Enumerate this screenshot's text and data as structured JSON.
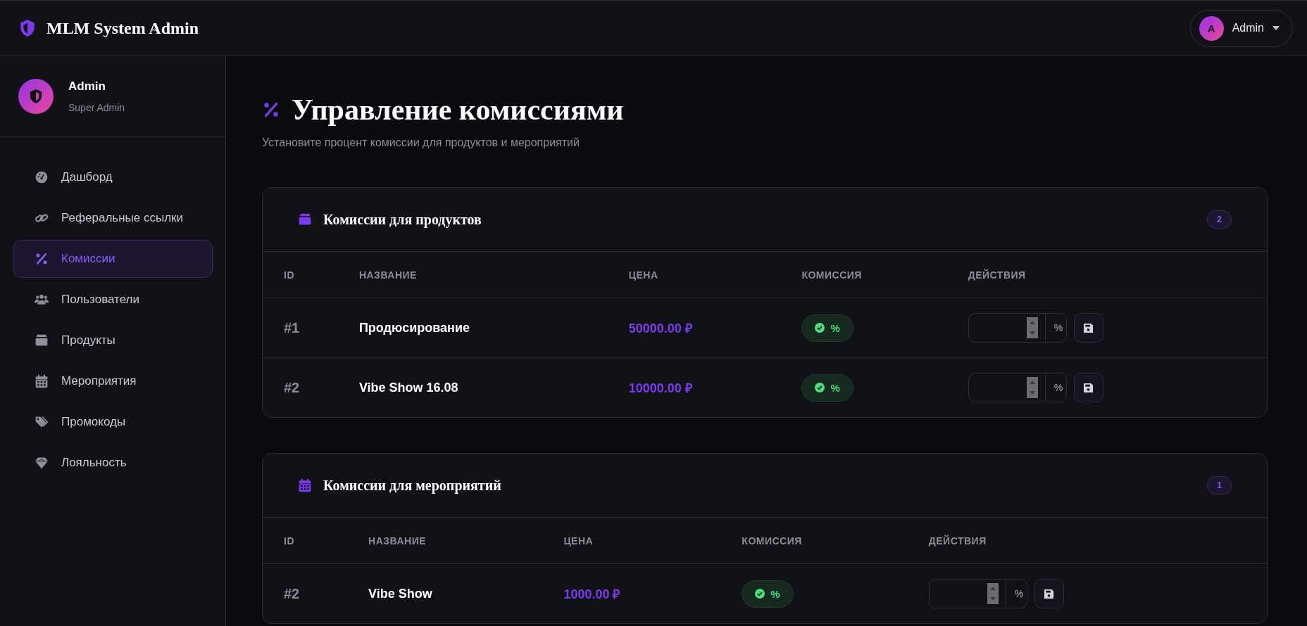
{
  "header": {
    "brand": "MLM System Admin",
    "user": {
      "initial": "A",
      "name": "Admin"
    }
  },
  "sidebar": {
    "profile": {
      "name": "Admin",
      "role": "Super Admin"
    },
    "items": [
      {
        "label": "Дашборд",
        "selected": false
      },
      {
        "label": "Реферальные ссылки",
        "selected": false
      },
      {
        "label": "Комиссии",
        "selected": true
      },
      {
        "label": "Пользователи",
        "selected": false
      },
      {
        "label": "Продукты",
        "selected": false
      },
      {
        "label": "Мероприятия",
        "selected": false
      },
      {
        "label": "Промокоды",
        "selected": false
      },
      {
        "label": "Лояльность",
        "selected": false
      }
    ]
  },
  "page": {
    "title": "Управление комиссиями",
    "subtitle": "Установите процент комиссии для продуктов и мероприятий"
  },
  "sections": [
    {
      "title": "Комиссии для продуктов",
      "count": "2",
      "columns": [
        "ID",
        "НАЗВАНИЕ",
        "ЦЕНА",
        "КОМИССИЯ",
        "ДЕЙСТВИЯ"
      ],
      "rows": [
        {
          "id": "#1",
          "name": "Продюсирование",
          "price": "50000.00 ₽",
          "commission": "%",
          "unit": "%"
        },
        {
          "id": "#2",
          "name": "Vibe Show 16.08",
          "price": "10000.00 ₽",
          "commission": "%",
          "unit": "%"
        }
      ]
    },
    {
      "title": "Комиссии для мероприятий",
      "count": "1",
      "columns": [
        "ID",
        "НАЗВАНИЕ",
        "ЦЕНА",
        "КОМИССИЯ",
        "ДЕЙСТВИЯ"
      ],
      "rows": [
        {
          "id": "#2",
          "name": "Vibe Show",
          "price": "1000.00 ₽",
          "commission": "%",
          "unit": "%"
        }
      ]
    }
  ]
}
